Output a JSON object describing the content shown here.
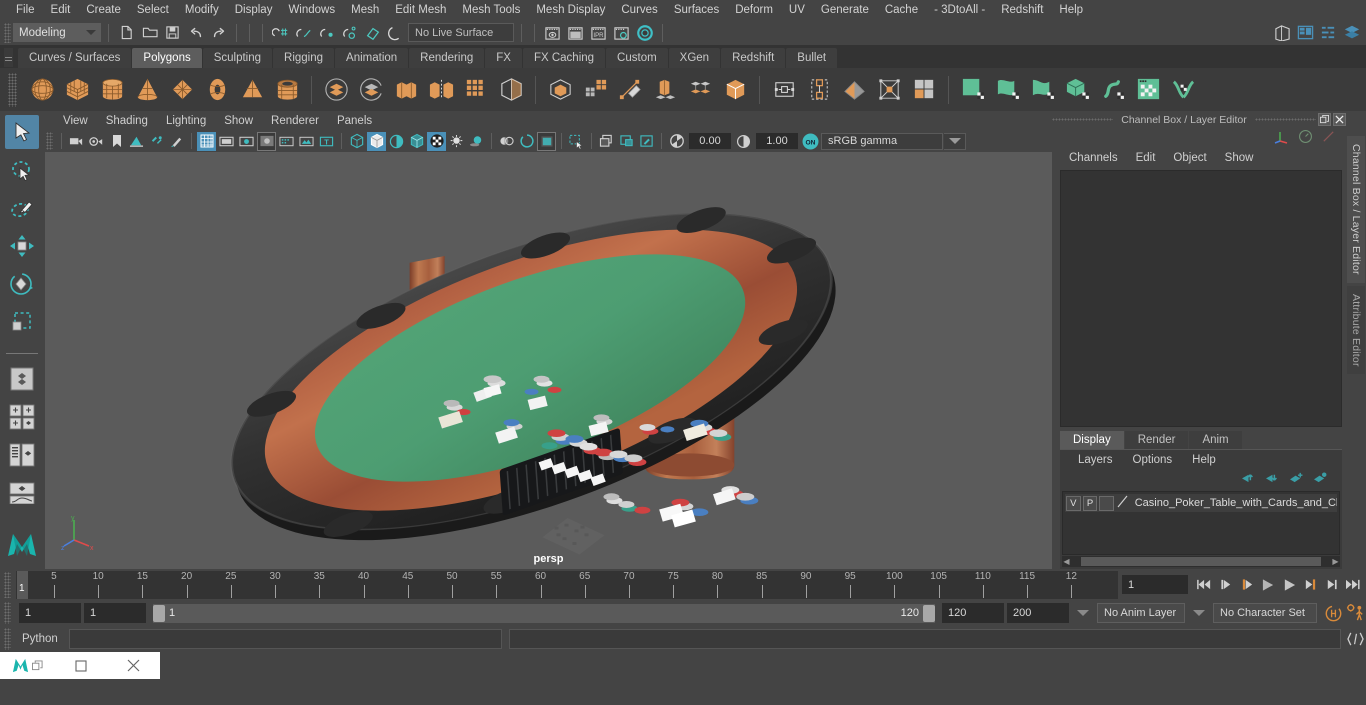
{
  "menubar": {
    "items": [
      "File",
      "Edit",
      "Create",
      "Select",
      "Modify",
      "Display",
      "Windows",
      "Mesh",
      "Edit Mesh",
      "Mesh Tools",
      "Mesh Display",
      "Curves",
      "Surfaces",
      "Deform",
      "UV",
      "Generate",
      "Cache",
      "- 3DtoAll -",
      "Redshift",
      "Help"
    ]
  },
  "statusline": {
    "mode": "Modeling",
    "live_surface": "No Live Surface",
    "icons": [
      "new-scene-icon",
      "open-scene-icon",
      "save-scene-icon",
      "undo-icon",
      "redo-icon",
      "select-by-hierarchy-icon",
      "select-by-object-icon",
      "select-by-component-icon",
      "snap-to-grid-icon",
      "snap-to-curve-icon",
      "snap-to-point-icon",
      "snap-to-projected-center-icon",
      "snap-to-view-plane-icon",
      "make-live-icon",
      "render-current-frame-icon",
      "ipr-render-icon",
      "render-settings-icon",
      "hypershade-icon",
      "render-view-icon"
    ],
    "right_icons": [
      "sidebar-toggle-icon",
      "attribute-editor-toggle-icon",
      "tool-settings-toggle-icon",
      "channel-box-toggle-icon"
    ]
  },
  "shelf": {
    "tabs": [
      "Curves / Surfaces",
      "Polygons",
      "Sculpting",
      "Rigging",
      "Animation",
      "Rendering",
      "FX",
      "FX Caching",
      "Custom",
      "XGen",
      "Redshift",
      "Bullet"
    ],
    "active_tab": "Polygons",
    "icons": [
      "poly-sphere-icon",
      "poly-cube-icon",
      "poly-cylinder-icon",
      "poly-cone-icon",
      "poly-plane-icon",
      "poly-torus-icon",
      "poly-pyramid-icon",
      "poly-pipe-icon",
      "poly-boolean-union-icon",
      "poly-boolean-difference-icon",
      "poly-combine-icon",
      "poly-separate-icon",
      "poly-smooth-icon",
      "poly-mirror-icon",
      "poly-extrude-icon",
      "poly-multicut-icon",
      "poly-bevel-icon",
      "poly-bridge-icon",
      "poly-merge-icon",
      "poly-target-weld-icon",
      "poly-quad-draw-icon",
      "poly-append-icon",
      "poly-fill-hole-icon",
      "poly-reduce-icon",
      "uv-planar-icon",
      "uv-cylindrical-icon",
      "uv-spherical-icon",
      "uv-automatic-icon",
      "uv-unfold-icon",
      "uv-editor-icon",
      "uv-layout-icon"
    ]
  },
  "toolbox": {
    "items": [
      {
        "name": "select-tool",
        "selected": true
      },
      {
        "name": "lasso-select-tool",
        "selected": false
      },
      {
        "name": "paint-select-tool",
        "selected": false
      },
      {
        "name": "move-tool",
        "selected": false
      },
      {
        "name": "rotate-tool",
        "selected": false
      },
      {
        "name": "scale-tool",
        "selected": false
      },
      {
        "name": "last-tool-used",
        "selected": false
      },
      {
        "name": "single-perspective-layout",
        "selected": false
      },
      {
        "name": "four-view-layout",
        "selected": false
      },
      {
        "name": "outliner-persp-layout",
        "selected": false
      },
      {
        "name": "persp-graph-layout",
        "selected": false
      }
    ]
  },
  "viewport": {
    "menus": [
      "View",
      "Shading",
      "Lighting",
      "Show",
      "Renderer",
      "Panels"
    ],
    "toolbar_icons": [
      "select-camera-icon",
      "camera-attributes-icon",
      "bookmark-icon",
      "image-plane-icon",
      "two-sided-lighting-icon",
      "paint-effects-icon",
      "grid-toggle-icon",
      "film-gate-icon",
      "resolution-gate-icon",
      "gate-mask-icon",
      "film-origin-icon",
      "exposure-icon",
      "xray-icon",
      "wireframe-icon",
      "smooth-shade-all-icon",
      "smooth-shade-flat-icon",
      "shaded-wireframe-icon",
      "textured-icon",
      "lighting-icon",
      "shadows-icon",
      "screen-space-ao-icon",
      "motion-blur-icon",
      "multisample-aa-icon",
      "depth-of-field-icon",
      "isolate-select-icon",
      "xray-joints-icon",
      "xray-active-icon",
      "display-layer-icon",
      "exposure-reset-icon"
    ],
    "exposure": "0.00",
    "gamma": "1.00",
    "color_management_toggle": "ON",
    "color_space": "sRGB gamma",
    "camera_label": "persp",
    "axis_labels": [
      "y",
      "z",
      "x"
    ]
  },
  "right_panel": {
    "title": "Channel Box / Layer Editor",
    "menus": [
      "Channels",
      "Edit",
      "Object",
      "Show"
    ],
    "header_icons": [
      "axis-gizmo-icon",
      "speedometer-icon",
      "slash-icon"
    ],
    "window_buttons": [
      "undock-icon",
      "close-icon"
    ],
    "layer_tabs": [
      "Display",
      "Render",
      "Anim"
    ],
    "active_layer_tab": "Display",
    "layer_menus": [
      "Layers",
      "Options",
      "Help"
    ],
    "layer_buttons": [
      "move-layer-up-icon",
      "move-layer-down-icon",
      "new-layer-icon",
      "new-layer-from-selected-icon"
    ],
    "layers": [
      {
        "visibility": "V",
        "playback": "P",
        "shading": "",
        "name": "Casino_Poker_Table_with_Cards_and_Ch"
      }
    ],
    "vertical_tabs": [
      "Channel Box / Layer Editor",
      "Attribute Editor"
    ]
  },
  "timeline": {
    "tick_labels": [
      "5",
      "10",
      "15",
      "20",
      "25",
      "30",
      "35",
      "40",
      "45",
      "50",
      "55",
      "60",
      "65",
      "70",
      "75",
      "80",
      "85",
      "90",
      "95",
      "100",
      "105",
      "110",
      "115",
      "12"
    ],
    "current_frame_marker": "1",
    "current_frame_field": "1",
    "playback_buttons": [
      "go-to-start-icon",
      "step-back-keyframe-icon",
      "step-back-frame-icon",
      "play-backwards-icon",
      "play-forwards-icon",
      "step-forward-frame-icon",
      "step-forward-keyframe-icon",
      "go-to-end-icon"
    ]
  },
  "range_slider": {
    "anim_start": "1",
    "range_start": "1",
    "bar_start_label": "1",
    "bar_end_label": "120",
    "range_end": "120",
    "anim_end": "200",
    "anim_layer": "No Anim Layer",
    "character_set": "No Character Set",
    "icons": [
      "auto-keyframe-icon",
      "animation-preferences-icon"
    ]
  },
  "command_line": {
    "label": "Python",
    "input_value": "",
    "output_value": "",
    "icon": "script-editor-icon"
  },
  "taskbar": {
    "buttons": [
      "maya-app-icon",
      "maximize-icon",
      "close-icon"
    ]
  }
}
